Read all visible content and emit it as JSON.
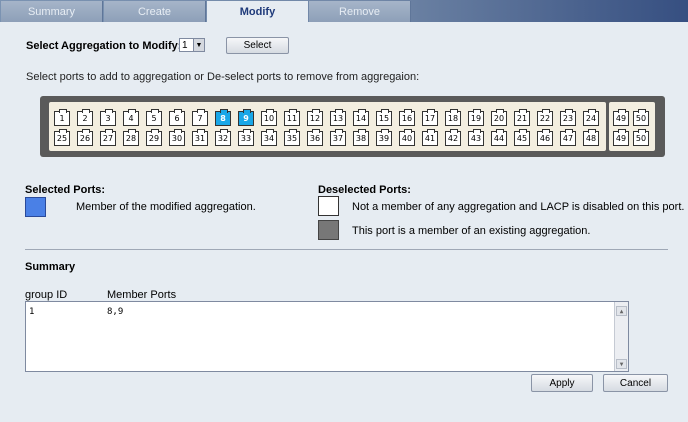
{
  "tabs": [
    "Summary",
    "Create",
    "Modify",
    "Remove"
  ],
  "select_aggregation_label": "Select Aggregation to Modify:",
  "aggregation_value": "1",
  "select_button": "Select",
  "instruction": "Select ports to add to aggregation or De-select ports to remove from aggregaion:",
  "ports": {
    "row1": [
      "1",
      "2",
      "3",
      "4",
      "5",
      "6",
      "7",
      "8",
      "9",
      "10",
      "11",
      "12",
      "13",
      "14",
      "15",
      "16",
      "17",
      "18",
      "19",
      "20",
      "21",
      "22",
      "23",
      "24"
    ],
    "row2": [
      "25",
      "26",
      "27",
      "28",
      "29",
      "30",
      "31",
      "32",
      "33",
      "34",
      "35",
      "36",
      "37",
      "38",
      "39",
      "40",
      "41",
      "42",
      "43",
      "44",
      "45",
      "46",
      "47",
      "48"
    ],
    "uplink_row1": [
      "49",
      "50"
    ],
    "uplink_row2": [
      "49",
      "50"
    ],
    "selected": [
      "8",
      "9"
    ]
  },
  "legend": {
    "selected_title": "Selected Ports:",
    "selected_desc": "Member of the modified aggregation.",
    "deselected_title": "Deselected Ports:",
    "not_member_desc": "Not a member of any aggregation and LACP is disabled on this port.",
    "existing_member_desc": "This port is a member of an existing aggregation.",
    "colors": {
      "selected": "#4a80e6",
      "not_member": "#ffffff",
      "existing": "#777777",
      "port_member": "#19a7e8"
    }
  },
  "summary": {
    "title": "Summary",
    "col_group": "group ID",
    "col_ports": "Member Ports",
    "row_group": "1",
    "row_ports": "8,9"
  },
  "buttons": {
    "apply": "Apply",
    "cancel": "Cancel"
  }
}
